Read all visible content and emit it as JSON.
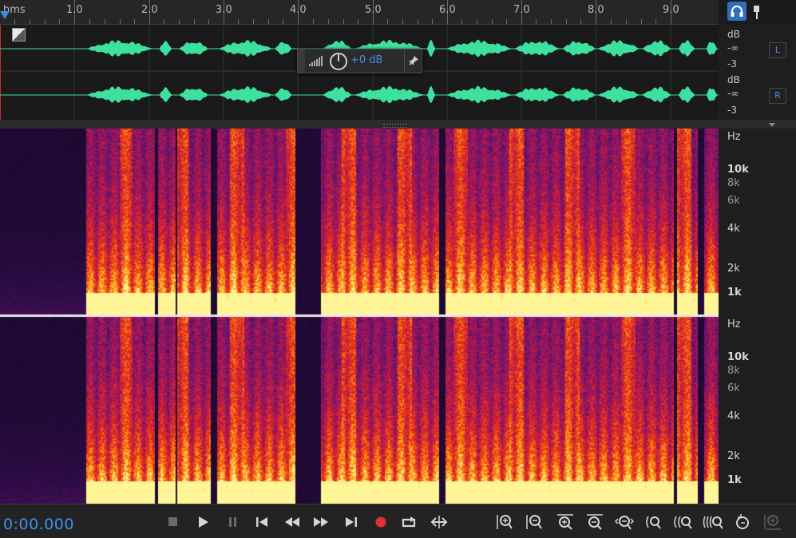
{
  "ruler": {
    "unit_label": "hms",
    "ticks": [
      "1.0",
      "2.0",
      "3.0",
      "4.0",
      "5.0",
      "6.0",
      "7.0",
      "8.0",
      "9.0"
    ]
  },
  "waveform": {
    "db_label": "dB",
    "neg_inf": "-∞",
    "minus_three": "-3",
    "left_channel": "L",
    "right_channel": "R"
  },
  "hud": {
    "gain": "+0 dB"
  },
  "spectrum": {
    "hz_label": "Hz",
    "ticks": [
      "10k",
      "8k",
      "6k",
      "4k",
      "2k",
      "1k"
    ]
  },
  "transport": {
    "time": "0:00.000"
  },
  "colors": {
    "accent": "#3f8fe8",
    "waveform": "#3ee0a0",
    "record": "#e03030"
  }
}
